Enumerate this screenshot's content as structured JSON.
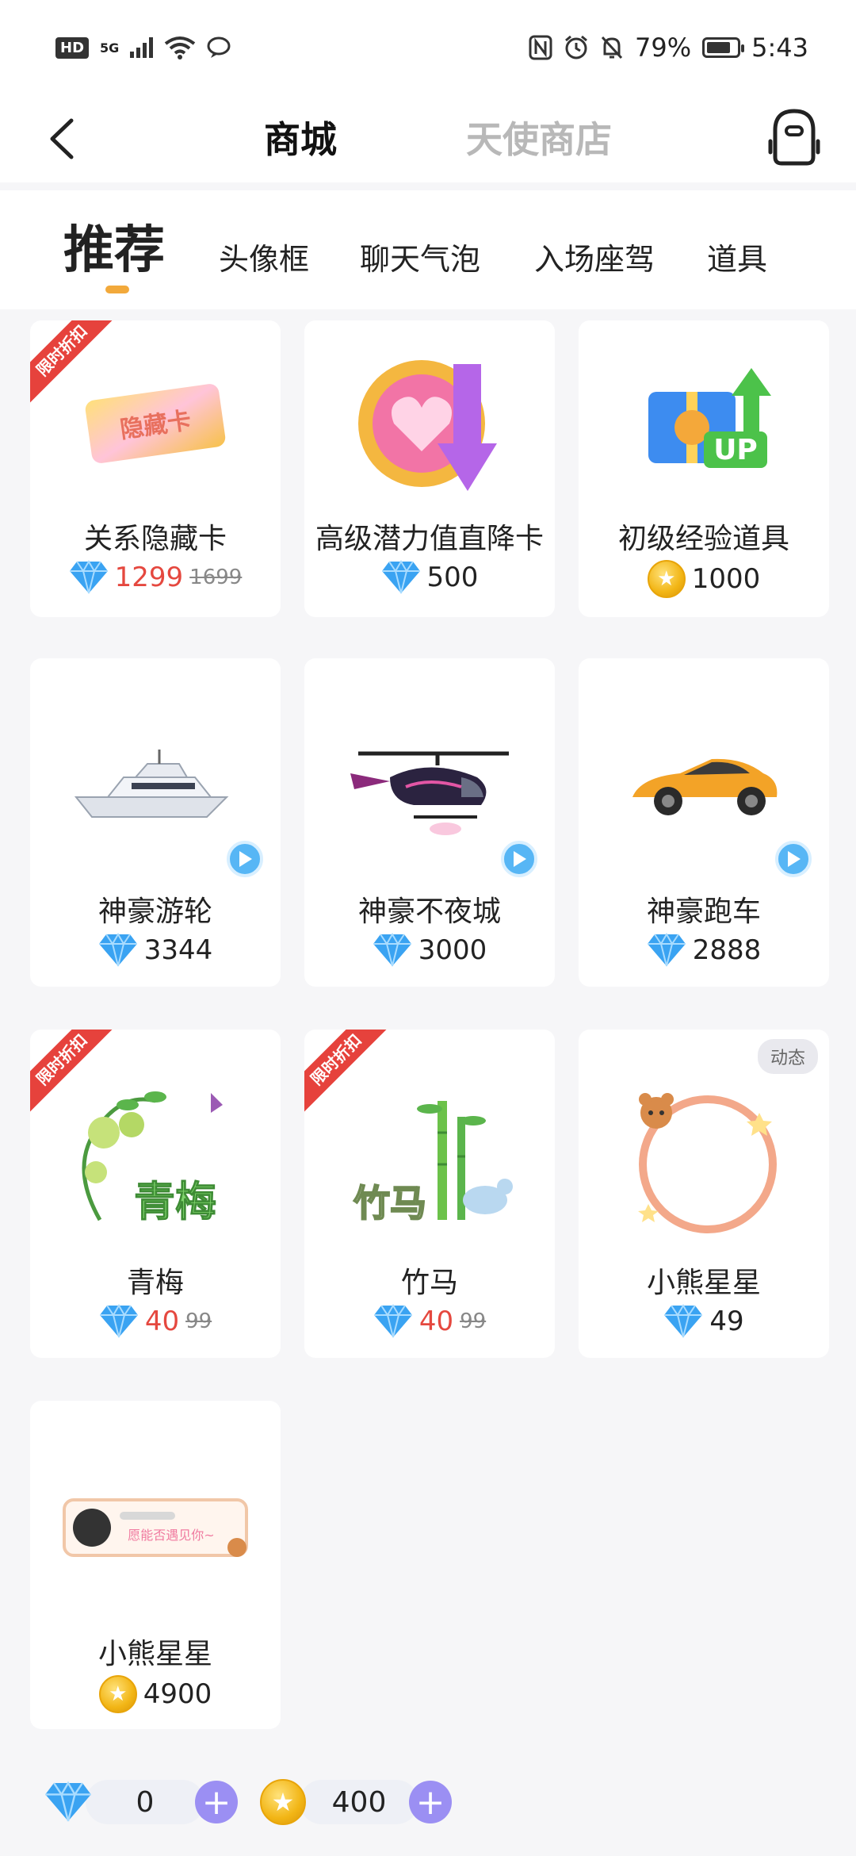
{
  "status_bar": {
    "hd": "HD",
    "network": "5G",
    "battery_percent": "79%",
    "time": "5:43",
    "battery_level": 0.79
  },
  "header": {
    "tabs": [
      {
        "label": "商城",
        "active": true
      },
      {
        "label": "天使商店",
        "active": false
      }
    ]
  },
  "categories": [
    {
      "label": "推荐",
      "active": true
    },
    {
      "label": "头像框",
      "active": false
    },
    {
      "label": "聊天气泡",
      "active": false
    },
    {
      "label": "入场座驾",
      "active": false
    },
    {
      "label": "道具",
      "active": false
    }
  ],
  "products": [
    {
      "name": "关系隐藏卡",
      "currency": "diamond",
      "price": "1299",
      "original_price": "1699",
      "badge": "限时折扣",
      "image_text": "隐藏卡"
    },
    {
      "name": "高级潜力值直降卡",
      "currency": "diamond",
      "price": "500"
    },
    {
      "name": "初级经验道具",
      "currency": "coin",
      "price": "1000",
      "image_text": "UP"
    },
    {
      "name": "神豪游轮",
      "currency": "diamond",
      "price": "3344",
      "has_preview": true
    },
    {
      "name": "神豪不夜城",
      "currency": "diamond",
      "price": "3000",
      "has_preview": true
    },
    {
      "name": "神豪跑车",
      "currency": "diamond",
      "price": "2888",
      "has_preview": true
    },
    {
      "name": "青梅",
      "currency": "diamond",
      "price": "40",
      "original_price": "99",
      "badge": "限时折扣",
      "image_text": "青梅"
    },
    {
      "name": "竹马",
      "currency": "diamond",
      "price": "40",
      "original_price": "99",
      "badge": "限时折扣",
      "image_text": "竹马"
    },
    {
      "name": "小熊星星",
      "currency": "diamond",
      "price": "49",
      "tag": "动态"
    },
    {
      "name": "小熊星星",
      "currency": "coin",
      "price": "4900",
      "image_text": "愿能否遇见你~"
    }
  ],
  "wallet": {
    "diamonds": "0",
    "coins": "400"
  },
  "colors": {
    "accent_indicator": "#f2a93b",
    "discount_price": "#e5483f",
    "badge": "#e6423c",
    "plus_button": "#9b8ff3",
    "diamond": "#3aa3f2"
  }
}
